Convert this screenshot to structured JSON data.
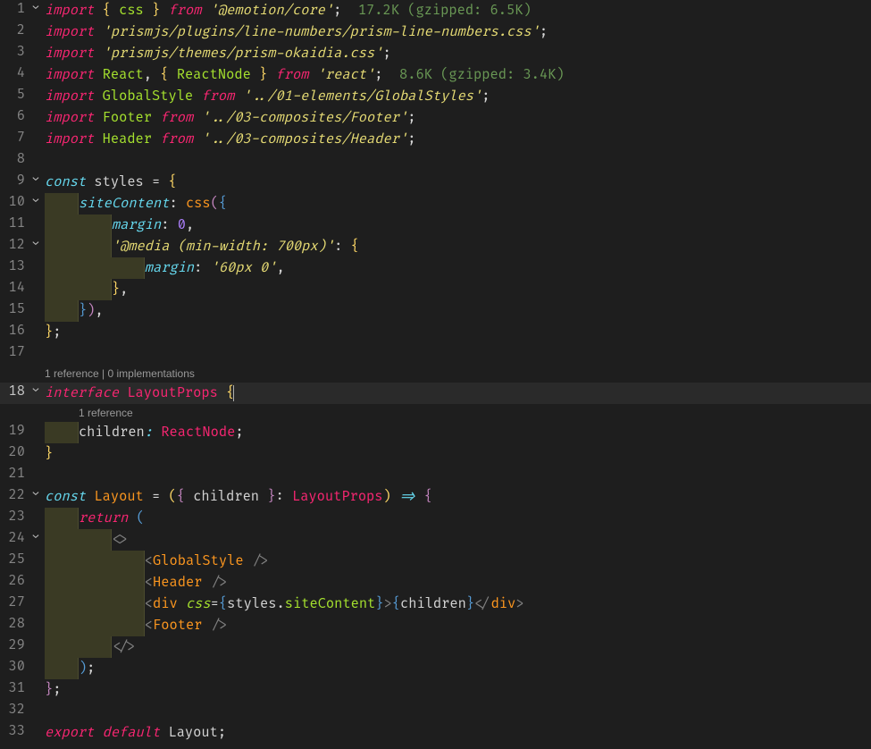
{
  "lines": {
    "l1": {
      "n": "1",
      "fold": "⌄",
      "tokens": [
        {
          "t": "import ",
          "c": "tok-keyword-imp"
        },
        {
          "t": "{ ",
          "c": "tok-brace-yellow"
        },
        {
          "t": "css ",
          "c": "tok-var"
        },
        {
          "t": "} ",
          "c": "tok-brace-yellow"
        },
        {
          "t": "from ",
          "c": "tok-keyword-imp"
        },
        {
          "t": "'@emotion/core'",
          "c": "tok-string"
        },
        {
          "t": ";  ",
          "c": "tok-punct"
        },
        {
          "t": "17.2K (gzipped: 6.5K)",
          "c": "tok-size"
        }
      ]
    },
    "l2": {
      "n": "2",
      "tokens": [
        {
          "t": "import ",
          "c": "tok-keyword-imp"
        },
        {
          "t": "'prismjs/plugins/line-numbers/prism-line-numbers.css'",
          "c": "tok-string"
        },
        {
          "t": ";",
          "c": "tok-punct"
        }
      ]
    },
    "l3": {
      "n": "3",
      "tokens": [
        {
          "t": "import ",
          "c": "tok-keyword-imp"
        },
        {
          "t": "'prismjs/themes/prism-okaidia.css'",
          "c": "tok-string"
        },
        {
          "t": ";",
          "c": "tok-punct"
        }
      ]
    },
    "l4": {
      "n": "4",
      "tokens": [
        {
          "t": "import ",
          "c": "tok-keyword-imp"
        },
        {
          "t": "React",
          "c": "tok-var"
        },
        {
          "t": ", ",
          "c": "tok-punct"
        },
        {
          "t": "{ ",
          "c": "tok-brace-yellow"
        },
        {
          "t": "ReactNode ",
          "c": "tok-var"
        },
        {
          "t": "} ",
          "c": "tok-brace-yellow"
        },
        {
          "t": "from ",
          "c": "tok-keyword-imp"
        },
        {
          "t": "'react'",
          "c": "tok-string"
        },
        {
          "t": ";  ",
          "c": "tok-punct"
        },
        {
          "t": "8.6K (gzipped: 3.4K)",
          "c": "tok-size"
        }
      ]
    },
    "l5": {
      "n": "5",
      "tokens": [
        {
          "t": "import ",
          "c": "tok-keyword-imp"
        },
        {
          "t": "GlobalStyle ",
          "c": "tok-var"
        },
        {
          "t": "from ",
          "c": "tok-keyword-imp"
        },
        {
          "t": "'../01-elements/GlobalStyles'",
          "c": "tok-string"
        },
        {
          "t": ";",
          "c": "tok-punct"
        }
      ]
    },
    "l6": {
      "n": "6",
      "tokens": [
        {
          "t": "import ",
          "c": "tok-keyword-imp"
        },
        {
          "t": "Footer ",
          "c": "tok-var"
        },
        {
          "t": "from ",
          "c": "tok-keyword-imp"
        },
        {
          "t": "'../03-composites/Footer'",
          "c": "tok-string"
        },
        {
          "t": ";",
          "c": "tok-punct"
        }
      ]
    },
    "l7": {
      "n": "7",
      "tokens": [
        {
          "t": "import ",
          "c": "tok-keyword-imp"
        },
        {
          "t": "Header ",
          "c": "tok-var"
        },
        {
          "t": "from ",
          "c": "tok-keyword-imp"
        },
        {
          "t": "'../03-composites/Header'",
          "c": "tok-string"
        },
        {
          "t": ";",
          "c": "tok-punct"
        }
      ]
    },
    "l8": {
      "n": "8",
      "tokens": [
        {
          "t": "",
          "c": ""
        }
      ]
    },
    "l9": {
      "n": "9",
      "fold": "⌄",
      "tokens": [
        {
          "t": "const ",
          "c": "tok-keyword-dec"
        },
        {
          "t": "styles ",
          "c": "tok-ident"
        },
        {
          "t": "= ",
          "c": "tok-punct"
        },
        {
          "t": "{",
          "c": "tok-brace-yellow"
        }
      ]
    },
    "l10": {
      "n": "10",
      "fold": "⌄",
      "tokens": [
        {
          "t": "    ",
          "c": "",
          "mark": true
        },
        {
          "t": "siteContent",
          "c": "tok-prop"
        },
        {
          "t": ": ",
          "c": "tok-punct"
        },
        {
          "t": "css",
          "c": "tok-call"
        },
        {
          "t": "(",
          "c": "tok-paren-p"
        },
        {
          "t": "{",
          "c": "tok-paren-b"
        }
      ]
    },
    "l11": {
      "n": "11",
      "tokens": [
        {
          "t": "        ",
          "c": "",
          "mark": true
        },
        {
          "t": "margin",
          "c": "tok-prop"
        },
        {
          "t": ": ",
          "c": "tok-punct"
        },
        {
          "t": "0",
          "c": "tok-num"
        },
        {
          "t": ",",
          "c": "tok-punct"
        }
      ]
    },
    "l12": {
      "n": "12",
      "fold": "⌄",
      "tokens": [
        {
          "t": "        ",
          "c": "",
          "mark": true
        },
        {
          "t": "'@media (min-width: 700px)'",
          "c": "tok-string"
        },
        {
          "t": ": ",
          "c": "tok-punct"
        },
        {
          "t": "{",
          "c": "tok-brace-yellow"
        }
      ]
    },
    "l13": {
      "n": "13",
      "tokens": [
        {
          "t": "            ",
          "c": "",
          "mark": true
        },
        {
          "t": "margin",
          "c": "tok-prop"
        },
        {
          "t": ": ",
          "c": "tok-punct"
        },
        {
          "t": "'60px 0'",
          "c": "tok-string"
        },
        {
          "t": ",",
          "c": "tok-punct"
        }
      ]
    },
    "l14": {
      "n": "14",
      "tokens": [
        {
          "t": "        ",
          "c": "",
          "mark": true
        },
        {
          "t": "}",
          "c": "tok-brace-yellow"
        },
        {
          "t": ",",
          "c": "tok-punct"
        }
      ]
    },
    "l15": {
      "n": "15",
      "tokens": [
        {
          "t": "    ",
          "c": "",
          "mark": true
        },
        {
          "t": "}",
          "c": "tok-paren-b"
        },
        {
          "t": ")",
          "c": "tok-paren-p"
        },
        {
          "t": ",",
          "c": "tok-punct"
        }
      ]
    },
    "l16": {
      "n": "16",
      "tokens": [
        {
          "t": "}",
          "c": "tok-brace-yellow"
        },
        {
          "t": ";",
          "c": "tok-punct"
        }
      ]
    },
    "l17": {
      "n": "17",
      "tokens": [
        {
          "t": "",
          "c": ""
        }
      ]
    },
    "codelens1": "1 reference | 0 implementations",
    "l18": {
      "n": "18",
      "fold": "⌄",
      "current": true,
      "tokens": [
        {
          "t": "interface ",
          "c": "tok-keyword-imp"
        },
        {
          "t": "LayoutProps ",
          "c": "tok-interface-name"
        },
        {
          "t": "{",
          "c": "tok-brace-yellow"
        }
      ]
    },
    "codelens2": "1 reference",
    "l19": {
      "n": "19",
      "tokens": [
        {
          "t": "    ",
          "c": "",
          "mark": true
        },
        {
          "t": "children",
          "c": "tok-ident"
        },
        {
          "t": ": ",
          "c": "tok-prop"
        },
        {
          "t": "ReactNode",
          "c": "tok-interface-name"
        },
        {
          "t": ";",
          "c": "tok-punct"
        }
      ]
    },
    "l20": {
      "n": "20",
      "tokens": [
        {
          "t": "}",
          "c": "tok-brace-yellow"
        }
      ]
    },
    "l21": {
      "n": "21",
      "tokens": [
        {
          "t": "",
          "c": ""
        }
      ]
    },
    "l22": {
      "n": "22",
      "fold": "⌄",
      "tokens": [
        {
          "t": "const ",
          "c": "tok-keyword-dec"
        },
        {
          "t": "Layout ",
          "c": "tok-call"
        },
        {
          "t": "= ",
          "c": "tok-punct"
        },
        {
          "t": "(",
          "c": "tok-brace-yellow"
        },
        {
          "t": "{ ",
          "c": "tok-paren-p"
        },
        {
          "t": "children ",
          "c": "tok-ident"
        },
        {
          "t": "}",
          "c": "tok-paren-p"
        },
        {
          "t": ": ",
          "c": "tok-punct"
        },
        {
          "t": "LayoutProps",
          "c": "tok-interface-name"
        },
        {
          "t": ")",
          "c": "tok-brace-yellow"
        },
        {
          "t": " => ",
          "c": "tok-arrow"
        },
        {
          "t": "{",
          "c": "tok-paren-p"
        }
      ]
    },
    "l23": {
      "n": "23",
      "tokens": [
        {
          "t": "    ",
          "c": "",
          "mark": true
        },
        {
          "t": "return ",
          "c": "tok-keyword-imp"
        },
        {
          "t": "(",
          "c": "tok-paren-b"
        }
      ]
    },
    "l24": {
      "n": "24",
      "fold": "⌄",
      "tokens": [
        {
          "t": "        ",
          "c": "",
          "mark": true
        },
        {
          "t": "<>",
          "c": "tok-jsx-ang"
        }
      ]
    },
    "l25": {
      "n": "25",
      "tokens": [
        {
          "t": "            ",
          "c": "",
          "mark": true
        },
        {
          "t": "<",
          "c": "tok-jsx-ang"
        },
        {
          "t": "GlobalStyle ",
          "c": "tok-jsx-tag"
        },
        {
          "t": "/>",
          "c": "tok-jsx-ang"
        }
      ]
    },
    "l26": {
      "n": "26",
      "tokens": [
        {
          "t": "            ",
          "c": "",
          "mark": true
        },
        {
          "t": "<",
          "c": "tok-jsx-ang"
        },
        {
          "t": "Header ",
          "c": "tok-jsx-tag"
        },
        {
          "t": "/>",
          "c": "tok-jsx-ang"
        }
      ]
    },
    "l27": {
      "n": "27",
      "tokens": [
        {
          "t": "            ",
          "c": "",
          "mark": true
        },
        {
          "t": "<",
          "c": "tok-jsx-ang"
        },
        {
          "t": "div ",
          "c": "tok-jsx-tag"
        },
        {
          "t": "css",
          "c": "tok-jsx-attr"
        },
        {
          "t": "=",
          "c": "tok-punct"
        },
        {
          "t": "{",
          "c": "tok-paren-b"
        },
        {
          "t": "styles",
          "c": "tok-ident"
        },
        {
          "t": ".",
          "c": "tok-punct"
        },
        {
          "t": "siteContent",
          "c": "tok-var"
        },
        {
          "t": "}",
          "c": "tok-paren-b"
        },
        {
          "t": ">",
          "c": "tok-jsx-ang"
        },
        {
          "t": "{",
          "c": "tok-paren-b"
        },
        {
          "t": "children",
          "c": "tok-ident"
        },
        {
          "t": "}",
          "c": "tok-paren-b"
        },
        {
          "t": "</",
          "c": "tok-jsx-ang"
        },
        {
          "t": "div",
          "c": "tok-jsx-tag"
        },
        {
          "t": ">",
          "c": "tok-jsx-ang"
        }
      ]
    },
    "l28": {
      "n": "28",
      "tokens": [
        {
          "t": "            ",
          "c": "",
          "mark": true
        },
        {
          "t": "<",
          "c": "tok-jsx-ang"
        },
        {
          "t": "Footer ",
          "c": "tok-jsx-tag"
        },
        {
          "t": "/>",
          "c": "tok-jsx-ang"
        }
      ]
    },
    "l29": {
      "n": "29",
      "tokens": [
        {
          "t": "        ",
          "c": "",
          "mark": true
        },
        {
          "t": "</>",
          "c": "tok-jsx-ang"
        }
      ]
    },
    "l30": {
      "n": "30",
      "tokens": [
        {
          "t": "    ",
          "c": "",
          "mark": true
        },
        {
          "t": ")",
          "c": "tok-paren-b"
        },
        {
          "t": ";",
          "c": "tok-punct"
        }
      ]
    },
    "l31": {
      "n": "31",
      "tokens": [
        {
          "t": "}",
          "c": "tok-paren-p"
        },
        {
          "t": ";",
          "c": "tok-punct"
        }
      ]
    },
    "l32": {
      "n": "32",
      "tokens": [
        {
          "t": "",
          "c": ""
        }
      ]
    },
    "l33": {
      "n": "33",
      "tokens": [
        {
          "t": "export default ",
          "c": "tok-keyword-imp"
        },
        {
          "t": "Layout",
          "c": "tok-ident"
        },
        {
          "t": ";",
          "c": "tok-punct"
        }
      ]
    }
  },
  "order": [
    "l1",
    "l2",
    "l3",
    "l4",
    "l5",
    "l6",
    "l7",
    "l8",
    "l9",
    "l10",
    "l11",
    "l12",
    "l13",
    "l14",
    "l15",
    "l16",
    "l17",
    "codelens1",
    "l18",
    "codelens2",
    "l19",
    "l20",
    "l21",
    "l22",
    "l23",
    "l24",
    "l25",
    "l26",
    "l27",
    "l28",
    "l29",
    "l30",
    "l31",
    "l32",
    "l33"
  ]
}
